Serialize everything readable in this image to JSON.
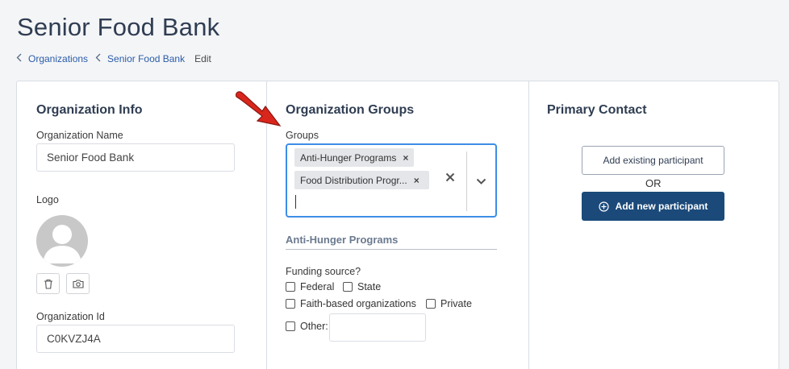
{
  "page": {
    "title": "Senior Food Bank"
  },
  "breadcrumb": [
    {
      "label": "Organizations"
    },
    {
      "label": "Senior Food Bank"
    }
  ],
  "breadcrumb_current": "Edit",
  "org_info": {
    "title": "Organization Info",
    "name_label": "Organization Name",
    "name_value": "Senior Food Bank",
    "logo_label": "Logo",
    "id_label": "Organization Id",
    "id_value": "C0KVZJ4A"
  },
  "org_groups": {
    "title": "Organization Groups",
    "groups_label": "Groups",
    "chips": [
      {
        "label": "Anti-Hunger Programs",
        "remove": "×"
      },
      {
        "label": "Food Distribution Progr...",
        "remove": "×"
      }
    ],
    "clear_icon": "close-icon",
    "dropdown_icon": "chevron-down-icon",
    "subsection_title": "Anti-Hunger Programs",
    "funding_label": "Funding source?",
    "options": {
      "federal": "Federal",
      "state": "State",
      "faith": "Faith-based organizations",
      "private": "Private",
      "other": "Other:"
    }
  },
  "primary_contact": {
    "title": "Primary Contact",
    "add_existing": "Add existing participant",
    "or": "OR",
    "add_new": "Add new participant"
  },
  "colors": {
    "accent": "#3d8ee6",
    "primary_button": "#1b4a7a",
    "title": "#2f3d52",
    "link": "#2a5ca8",
    "arrow": "#d9261c"
  }
}
